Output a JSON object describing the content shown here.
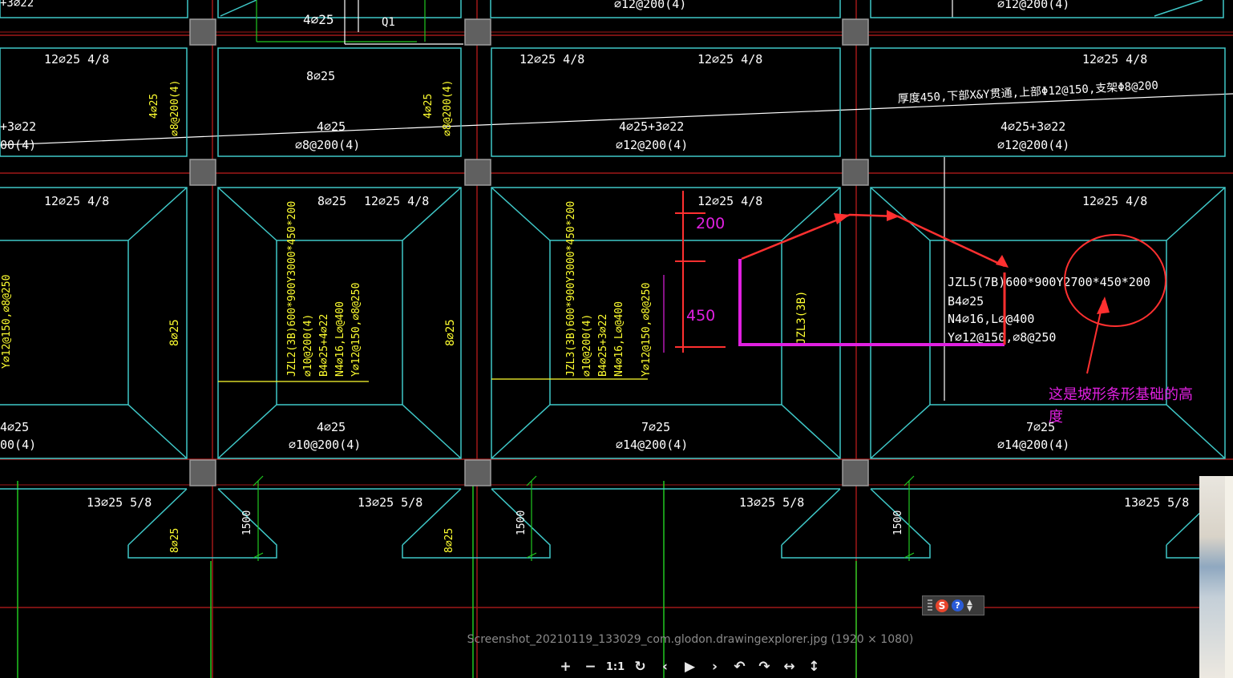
{
  "viewer": {
    "caption": "Screenshot_20210119_133029_com.glodon.drawingexplorer.jpg (1920 × 1080)",
    "toolbar": [
      {
        "name": "zoom-in",
        "glyph": "+"
      },
      {
        "name": "zoom-out",
        "glyph": "−"
      },
      {
        "name": "actual-size",
        "glyph": "1:1"
      },
      {
        "name": "refresh",
        "glyph": "↻"
      },
      {
        "name": "prev",
        "glyph": "‹"
      },
      {
        "name": "play",
        "glyph": "▶"
      },
      {
        "name": "next",
        "glyph": "›"
      },
      {
        "name": "rotate-left",
        "glyph": "↶"
      },
      {
        "name": "rotate-right",
        "glyph": "↷"
      },
      {
        "name": "flip-horizontal",
        "glyph": "↔"
      },
      {
        "name": "flip-vertical",
        "glyph": "↕"
      }
    ]
  },
  "ime": {
    "logo": "S",
    "help": "?"
  },
  "drawing": {
    "colors": {
      "grid": "#a01818",
      "outline": "#3fc8c8",
      "text": "#ffffff",
      "yellow": "#ffff30",
      "green": "#20c820",
      "magenta": "#e020e0",
      "red": "#ff3030"
    },
    "labels": {
      "top_a": "+3⌀22",
      "top_b": "4⌀25",
      "top_c": "Q1",
      "top_d": "⌀12@200(4)",
      "top_e": "⌀12@200(4)",
      "r2_a": "12⌀25 4/8",
      "r2_b": "8⌀25",
      "r2_c": "12⌀25 4/8",
      "r2_d": "12⌀25 4/8",
      "r2_e": "12⌀25 4/8",
      "r2_f": "+3⌀22",
      "r2_g": "00(4)",
      "r2_h": "4⌀25",
      "r2_i": "⌀8@200(4)",
      "r2_j": "4⌀25+3⌀22",
      "r2_k": "⌀12@200(4)",
      "r2_l": "4⌀25+3⌀22",
      "r2_m": "⌀12@200(4)",
      "r2_n": "4⌀25",
      "r2_o": "⌀8@200(4)",
      "r2_p": "4⌀25",
      "r2_q": "⌀8@200(4)",
      "slab_note": "厚度450,下部X&Y贯通,上部Φ12@150,支架Φ8@200",
      "r3_a": "12⌀25 4/8",
      "r3_b": "8⌀25",
      "r3_c": "12⌀25 4/8",
      "r3_d": "12⌀25 4/8",
      "r3_e": "12⌀25 4/8",
      "v1": "Y⌀12@150,⌀8@250",
      "v2": "8⌀25",
      "v3": "JZL2(3B)600*900Y3000*450*200",
      "v4": "⌀10@200(4)",
      "v5": "B4⌀25+4⌀22",
      "v6": "N4⌀16,L⌀@400",
      "v7": "Y⌀12@150,⌀8@250",
      "v8": "8⌀25",
      "v9": "JZL3(3B)600*900Y3000*450*200",
      "v10": "⌀10@200(4)",
      "v11": "B4⌀25+3⌀22",
      "v12": "N4⌀16,L⌀@400",
      "v13": "Y⌀12@150,⌀8@250",
      "v14": "JZL3(3B)",
      "dim_200": "200",
      "dim_450": "450",
      "jz1": "JZL5(7B)600*900Y2700*450*200",
      "jz2": "B4⌀25",
      "jz3": "N4⌀16,L⌀@400",
      "jz4": "Y⌀12@150,⌀8@250",
      "note": "这是坡形条形基础的高度",
      "r4_a": "4⌀25",
      "r4_b": "00(4)",
      "r4_c": "4⌀25",
      "r4_d": "⌀10@200(4)",
      "r4_e": "7⌀25",
      "r4_f": "⌀14@200(4)",
      "r4_g": "7⌀25",
      "r4_h": "⌀14@200(4)",
      "r5_a": "13⌀25 5/8",
      "r5_b": "13⌀25 5/8",
      "r5_c": "13⌀25 5/8",
      "r5_d": "13⌀25 5/8",
      "r5_e": "1500",
      "r5_f": "1500",
      "r5_g": "1500",
      "r5_h": "8⌀25",
      "r5_i": "8⌀25"
    }
  }
}
